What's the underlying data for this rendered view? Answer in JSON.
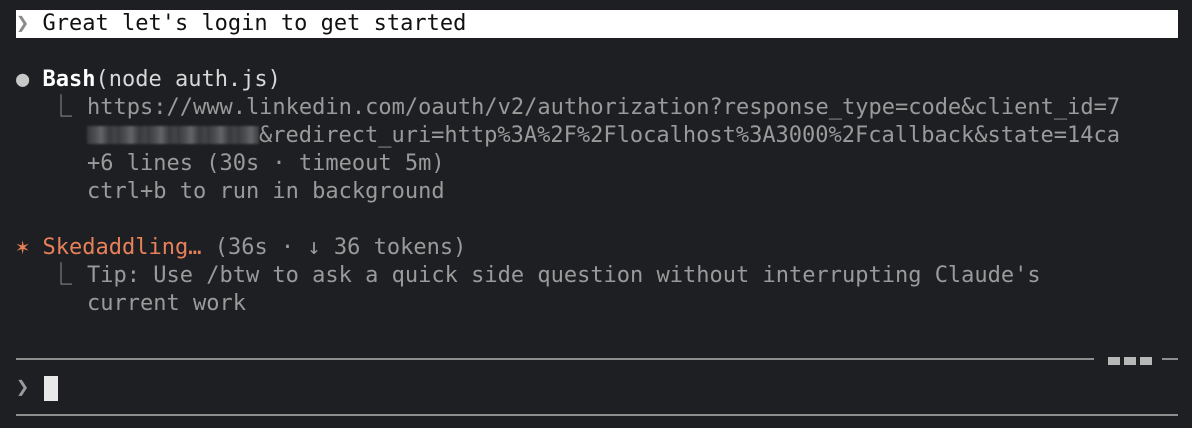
{
  "user_prompt": {
    "chevron": "❯",
    "text": "Great let's login to get started"
  },
  "tool_call": {
    "bullet": "●",
    "tool_name": "Bash",
    "args": "(node auth.js)",
    "branch": "⎿",
    "output_line1": "https://www.linkedin.com/oauth/v2/authorization?response_type=code&client_id=7",
    "output_line2_rest": "&redirect_uri=http%3A%2F%2Flocalhost%3A3000%2Fcallback&state=14ca",
    "more_lines": "+6 lines (30s · timeout 5m)",
    "hint": "ctrl+b to run in background"
  },
  "status": {
    "star": "✶",
    "label": "Skedaddling…",
    "meta": "(36s · ↓ 36 tokens)",
    "branch": "⎿",
    "tip_line1": "Tip: Use /btw to ask a quick side question without interrupting Claude's",
    "tip_line2": "current work"
  },
  "input": {
    "chevron": "❯",
    "value": ""
  },
  "colors": {
    "background": "#1e1f22",
    "accent": "#e8805a",
    "prompt_highlight": "#ffffff"
  }
}
